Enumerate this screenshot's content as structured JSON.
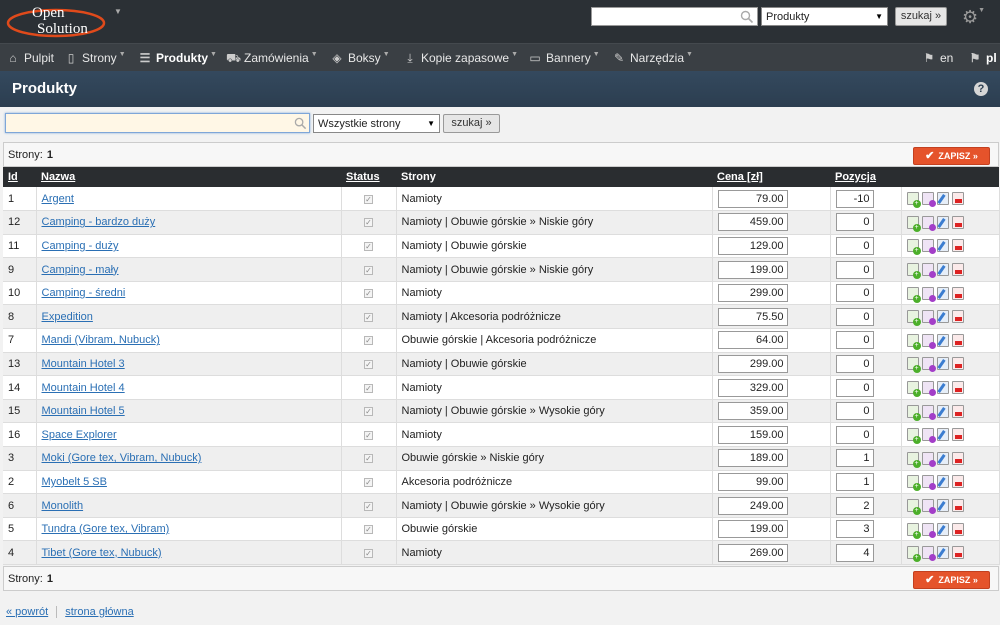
{
  "logo": {
    "line1": "Open",
    "line2": "Solution"
  },
  "top": {
    "search_value": "",
    "select_value": "Produkty",
    "search_btn": "szukaj »"
  },
  "nav": {
    "items": [
      {
        "label": "Pulpit",
        "icon": "home-icon"
      },
      {
        "label": "Strony",
        "icon": "page-icon"
      },
      {
        "label": "Produkty",
        "icon": "list-icon"
      },
      {
        "label": "Zamówienia",
        "icon": "cart-icon"
      },
      {
        "label": "Boksy",
        "icon": "box-icon"
      },
      {
        "label": "Kopie zapasowe",
        "icon": "download-icon"
      },
      {
        "label": "Bannery",
        "icon": "image-icon"
      },
      {
        "label": "Narzędzia",
        "icon": "wrench-icon"
      }
    ],
    "lang_en": "en",
    "lang_pl": "pl"
  },
  "page": {
    "title": "Produkty"
  },
  "filter": {
    "input_value": "",
    "select_value": "Wszystkie strony",
    "search_btn": "szukaj »"
  },
  "pager": {
    "label": "Strony:",
    "page": "1",
    "save_label": "ZAPISZ »"
  },
  "table": {
    "headers": {
      "id": "Id",
      "name": "Nazwa",
      "status": "Status",
      "pages": "Strony",
      "price": "Cena [zł]",
      "position": "Pozycja"
    },
    "rows": [
      {
        "id": "1",
        "name": "Argent",
        "pages": "Namioty",
        "price": "79.00",
        "position": "-10"
      },
      {
        "id": "12",
        "name": "Camping - bardzo duży",
        "pages": "Namioty | Obuwie górskie » Niskie góry",
        "price": "459.00",
        "position": "0"
      },
      {
        "id": "11",
        "name": "Camping - duży",
        "pages": "Namioty | Obuwie górskie",
        "price": "129.00",
        "position": "0"
      },
      {
        "id": "9",
        "name": "Camping - mały",
        "pages": "Namioty | Obuwie górskie » Niskie góry",
        "price": "199.00",
        "position": "0"
      },
      {
        "id": "10",
        "name": "Camping - średni",
        "pages": "Namioty",
        "price": "299.00",
        "position": "0"
      },
      {
        "id": "8",
        "name": "Expedition",
        "pages": "Namioty | Akcesoria podróżnicze",
        "price": "75.50",
        "position": "0"
      },
      {
        "id": "7",
        "name": "Mandi (Vibram, Nubuck)",
        "pages": "Obuwie górskie | Akcesoria podróżnicze",
        "price": "64.00",
        "position": "0"
      },
      {
        "id": "13",
        "name": "Mountain Hotel 3",
        "pages": "Namioty | Obuwie górskie",
        "price": "299.00",
        "position": "0"
      },
      {
        "id": "14",
        "name": "Mountain Hotel 4",
        "pages": "Namioty",
        "price": "329.00",
        "position": "0"
      },
      {
        "id": "15",
        "name": "Mountain Hotel 5",
        "pages": "Namioty | Obuwie górskie » Wysokie góry",
        "price": "359.00",
        "position": "0"
      },
      {
        "id": "16",
        "name": "Space Explorer",
        "pages": "Namioty",
        "price": "159.00",
        "position": "0"
      },
      {
        "id": "3",
        "name": "Moki (Gore tex, Vibram, Nubuck)",
        "pages": "Obuwie górskie » Niskie góry",
        "price": "189.00",
        "position": "1"
      },
      {
        "id": "2",
        "name": "Myobelt 5 SB",
        "pages": "Akcesoria podróżnicze",
        "price": "99.00",
        "position": "1"
      },
      {
        "id": "6",
        "name": "Monolith",
        "pages": "Namioty | Obuwie górskie » Wysokie góry",
        "price": "249.00",
        "position": "2"
      },
      {
        "id": "5",
        "name": "Tundra (Gore tex, Vibram)",
        "pages": "Obuwie górskie",
        "price": "199.00",
        "position": "3"
      },
      {
        "id": "4",
        "name": "Tibet (Gore tex, Nubuck)",
        "pages": "Namioty",
        "price": "269.00",
        "position": "4"
      }
    ]
  },
  "footer": {
    "back": "« powrót",
    "home": "strona główna"
  }
}
